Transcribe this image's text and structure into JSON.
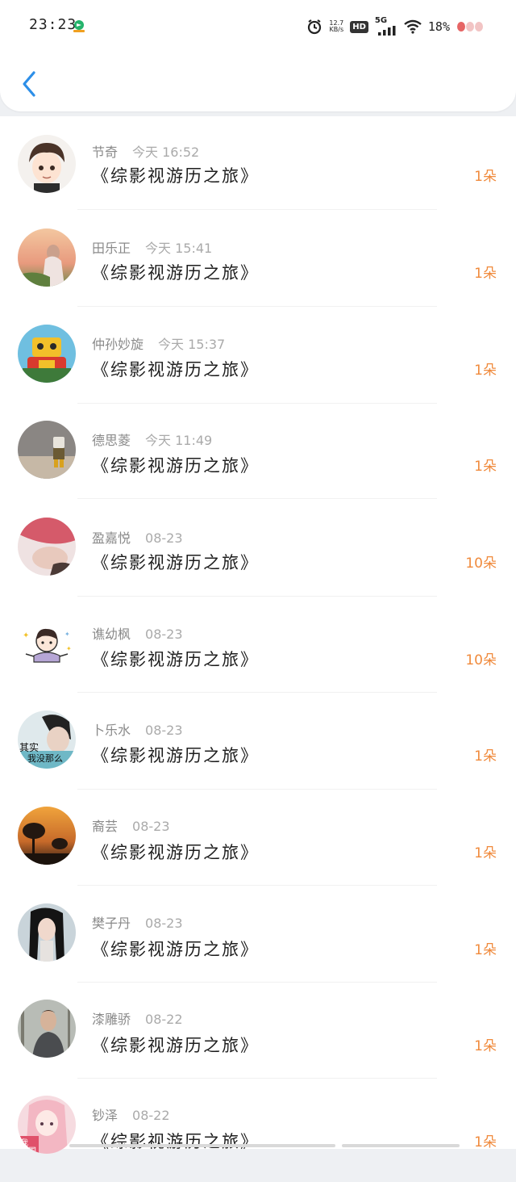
{
  "status_bar": {
    "time": "23:23",
    "net_speed_value": "12.7",
    "net_speed_unit": "KB/s",
    "hd": "HD",
    "network": "5G",
    "battery": "18%"
  },
  "header": {
    "back_icon": "chevron-left-icon"
  },
  "colors": {
    "accent_blue": "#2d8fe8",
    "amount_orange": "#f08a3c"
  },
  "gifts": [
    {
      "name": "节奇",
      "time": "今天 16:52",
      "book": "《综影视游历之旅》",
      "amount": "1朵",
      "avatar": "cartoon-boy"
    },
    {
      "name": "田乐正",
      "time": "今天 15:41",
      "book": "《综影视游历之旅》",
      "amount": "1朵",
      "avatar": "sunset-girl"
    },
    {
      "name": "仲孙妙旋",
      "time": "今天 15:37",
      "book": "《综影视游历之旅》",
      "amount": "1朵",
      "avatar": "robot-toy"
    },
    {
      "name": "德思菱",
      "time": "今天 11:49",
      "book": "《综影视游历之旅》",
      "amount": "1朵",
      "avatar": "toy-figure"
    },
    {
      "name": "盈嘉悦",
      "time": "08-23",
      "book": "《综影视游历之旅》",
      "amount": "10朵",
      "avatar": "hand-photo"
    },
    {
      "name": "谯幼枫",
      "time": "08-23",
      "book": "《综影视游历之旅》",
      "amount": "10朵",
      "avatar": "cartoon-kid"
    },
    {
      "name": "卜乐水",
      "time": "08-23",
      "book": "《综影视游历之旅》",
      "amount": "1朵",
      "avatar": "boy-photo"
    },
    {
      "name": "裔芸",
      "time": "08-23",
      "book": "《综影视游历之旅》",
      "amount": "1朵",
      "avatar": "tree-sunset"
    },
    {
      "name": "樊子丹",
      "time": "08-23",
      "book": "《综影视游历之旅》",
      "amount": "1朵",
      "avatar": "girl-portrait"
    },
    {
      "name": "漆雕骄",
      "time": "08-22",
      "book": "《综影视游历之旅》",
      "amount": "1朵",
      "avatar": "man-portrait"
    },
    {
      "name": "钞泽",
      "time": "08-22",
      "book": "《综影视游历之旅》",
      "amount": "1朵",
      "avatar": "anime-girl"
    }
  ],
  "avatar_text": {
    "boy_photo_line1": "其实",
    "boy_photo_line2": "我没那么",
    "anime_line1": "我",
    "anime_line2": "祖国"
  }
}
